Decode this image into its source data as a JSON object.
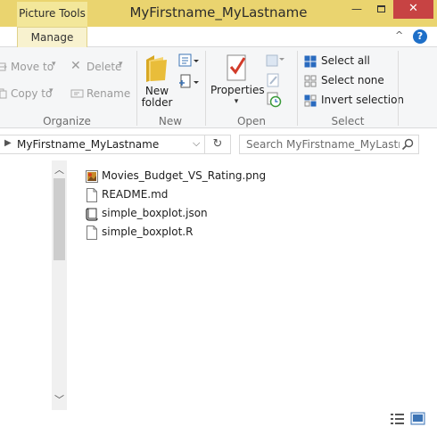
{
  "window": {
    "title": "MyFirstname_MyLastname",
    "context_tab": "Picture Tools",
    "context_subtab": "Manage",
    "minimize": "—",
    "close": "✕",
    "collapse_chevron": "^",
    "help": "?"
  },
  "ribbon": {
    "organize": {
      "label": "Organize",
      "move_to": "Move to",
      "copy_to": "Copy to",
      "delete": "Delete",
      "rename": "Rename"
    },
    "new": {
      "label": "New",
      "new_folder_line1": "New",
      "new_folder_line2": "folder"
    },
    "open": {
      "label": "Open",
      "properties": "Properties"
    },
    "select": {
      "label": "Select",
      "select_all": "Select all",
      "select_none": "Select none",
      "invert_selection": "Invert selection"
    }
  },
  "address": {
    "path": "MyFirstname_MyLastname",
    "search_placeholder": "Search MyFirstname_MyLastn..."
  },
  "files": [
    {
      "name": "Movies_Budget_VS_Rating.png",
      "icon": "png-image-icon"
    },
    {
      "name": "README.md",
      "icon": "document-icon"
    },
    {
      "name": "simple_boxplot.json",
      "icon": "json-file-icon"
    },
    {
      "name": "simple_boxplot.R",
      "icon": "document-icon"
    }
  ],
  "colors": {
    "titlebar": "#ead46f",
    "context_tab": "#f3e79a",
    "close_button": "#c74343",
    "accent_blue": "#1e6fc8"
  }
}
